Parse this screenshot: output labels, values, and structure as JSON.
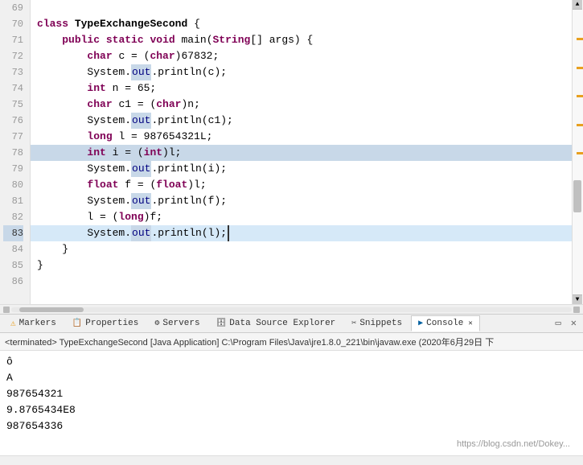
{
  "editor": {
    "lines": [
      {
        "num": 69,
        "content": [],
        "active": false,
        "highlighted": false
      },
      {
        "num": 70,
        "content": "class TypeExchangeSecond {",
        "active": false,
        "highlighted": false
      },
      {
        "num": 71,
        "content": null,
        "special": "method_sig",
        "active": false,
        "highlighted": false
      },
      {
        "num": 72,
        "content": null,
        "special": "char_c",
        "active": false,
        "highlighted": false
      },
      {
        "num": 73,
        "content": null,
        "special": "sys_out_c",
        "active": false,
        "highlighted": false
      },
      {
        "num": 74,
        "content": null,
        "special": "int_n",
        "active": false,
        "highlighted": false
      },
      {
        "num": 75,
        "content": null,
        "special": "char_c1",
        "active": false,
        "highlighted": false
      },
      {
        "num": 76,
        "content": null,
        "special": "sys_out_c1",
        "active": false,
        "highlighted": false
      },
      {
        "num": 77,
        "content": null,
        "special": "long_l",
        "active": false,
        "highlighted": false
      },
      {
        "num": 78,
        "content": null,
        "special": "int_i",
        "active": false,
        "highlighted": true
      },
      {
        "num": 79,
        "content": null,
        "special": "sys_out_i",
        "active": false,
        "highlighted": false
      },
      {
        "num": 80,
        "content": null,
        "special": "float_f",
        "active": false,
        "highlighted": false
      },
      {
        "num": 81,
        "content": null,
        "special": "sys_out_f",
        "active": false,
        "highlighted": false
      },
      {
        "num": 82,
        "content": null,
        "special": "l_long_f",
        "active": false,
        "highlighted": false
      },
      {
        "num": 83,
        "content": null,
        "special": "sys_out_l",
        "active": false,
        "highlighted": true,
        "active_line": true
      },
      {
        "num": 84,
        "content": "    }",
        "active": false,
        "highlighted": false
      },
      {
        "num": 85,
        "content": "}",
        "active": false,
        "highlighted": false
      },
      {
        "num": 86,
        "content": "",
        "active": false,
        "highlighted": false
      }
    ]
  },
  "tabs": [
    {
      "label": "Markers",
      "icon": "marker",
      "active": false
    },
    {
      "label": "Properties",
      "icon": "props",
      "active": false
    },
    {
      "label": "Servers",
      "icon": "server",
      "active": false
    },
    {
      "label": "Data Source Explorer",
      "icon": "datasource",
      "active": false
    },
    {
      "label": "Snippets",
      "icon": "snippets",
      "active": false
    },
    {
      "label": "Console",
      "icon": "console",
      "active": true
    }
  ],
  "console": {
    "header": "<terminated> TypeExchangeSecond [Java Application] C:\\Program Files\\Java\\jre1.8.0_221\\bin\\javaw.exe (2020年6月29日 下",
    "output": [
      "ô",
      "A",
      "987654321",
      "9.8765434E8",
      "987654336"
    ]
  },
  "watermark": "https://blog.csdn.net/Dokey...",
  "scrollbar": {
    "label": "scrollbar"
  }
}
